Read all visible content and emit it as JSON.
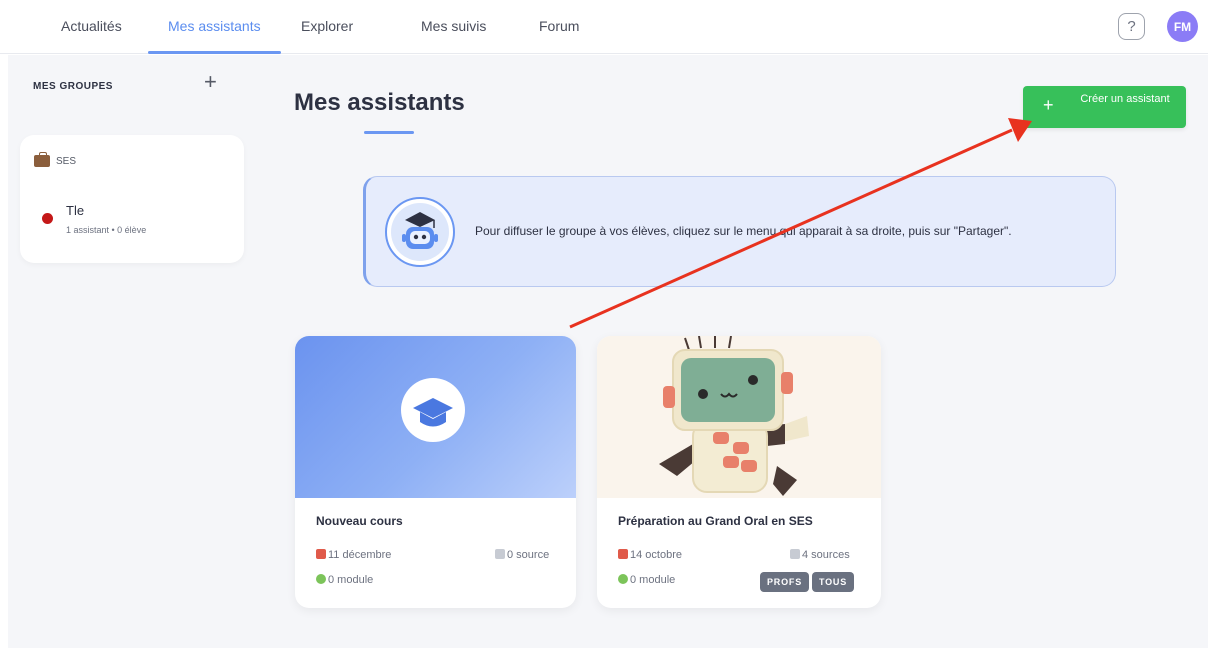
{
  "nav": {
    "tabs": [
      {
        "label": "Actualités"
      },
      {
        "label": "Mes assistants"
      },
      {
        "label": "Explorer"
      },
      {
        "label": "Mes suivis"
      },
      {
        "label": "Forum"
      }
    ],
    "active_tab": "Mes assistants",
    "help_label": "?",
    "avatar_initials": "FM",
    "avatar_color": "#8b7cf6"
  },
  "sidebar": {
    "title": "MES GROUPES",
    "add_label": "+",
    "groups": [
      {
        "name": "SES",
        "icon": "briefcase-icon",
        "classes": [
          {
            "name": "Tle",
            "meta": "1 assistant • 0 élève",
            "dot_color": "#c41818"
          }
        ]
      }
    ]
  },
  "main": {
    "title": "Mes assistants",
    "create_button": {
      "plus": "+",
      "label": "Créer un assistant",
      "color": "#37c05a"
    },
    "banner_text": "Pour diffuser le groupe à vos élèves, cliquez sur le menu qui apparait à sa droite, puis sur \"Partager\".",
    "accent_color": "#6b97f2"
  },
  "cards": [
    {
      "title": "Nouveau cours",
      "date": "11 décembre",
      "sources": "0 source",
      "modules": "0 module",
      "image": "graduation-cap-icon",
      "tags": []
    },
    {
      "title": "Préparation au Grand Oral en SES",
      "date": "14 octobre",
      "sources": "4 sources",
      "modules": "0 module",
      "image": "robot-illustration",
      "tags": [
        "PROFS",
        "TOUS"
      ]
    }
  ],
  "annotation": {
    "color": "#e8321f"
  }
}
